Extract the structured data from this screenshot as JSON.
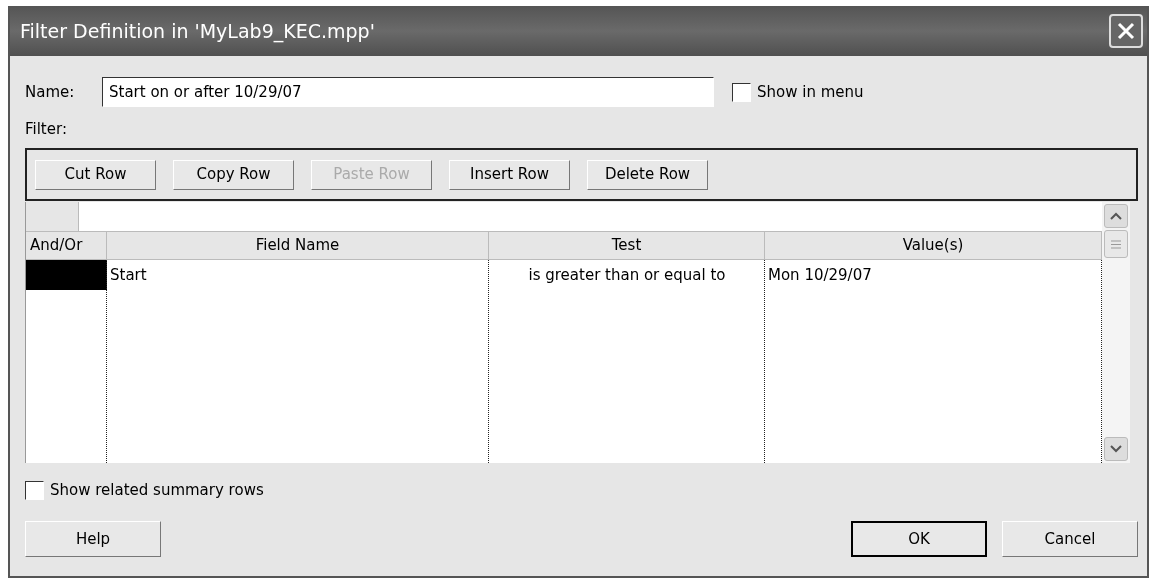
{
  "window": {
    "title": "Filter Definition in 'MyLab9_KEC.mpp'"
  },
  "name_field": {
    "label": "Name:",
    "value": "Start on or after 10/29/07"
  },
  "show_in_menu": {
    "label": "Show in menu",
    "checked": false
  },
  "filter_label": {
    "label": "Filter:"
  },
  "toolbar": [
    {
      "label": "Cut Row",
      "disabled": false
    },
    {
      "label": "Copy Row",
      "disabled": false
    },
    {
      "label": "Paste Row",
      "disabled": true
    },
    {
      "label": "Insert Row",
      "disabled": false
    },
    {
      "label": "Delete Row",
      "disabled": false
    }
  ],
  "table": {
    "columns": [
      "And/Or",
      "Field Name",
      "Test",
      "Value(s)"
    ],
    "rows": [
      {
        "selected": true,
        "cells": [
          "",
          "Start",
          "is greater than or equal to",
          "Mon 10/29/07"
        ]
      }
    ]
  },
  "show_related": {
    "label": "Show related summary rows",
    "checked": false
  },
  "buttons": [
    {
      "label": "Help",
      "kind": "help",
      "default": false
    },
    {
      "label": "OK",
      "kind": "ok",
      "default": true
    },
    {
      "label": "Cancel",
      "kind": "cancel",
      "default": false
    }
  ]
}
